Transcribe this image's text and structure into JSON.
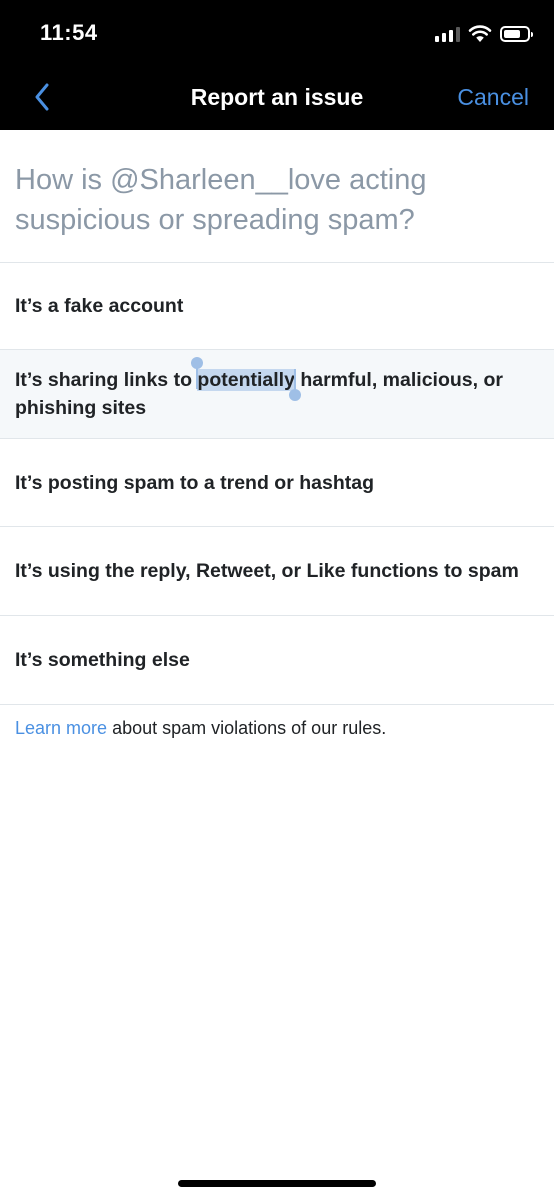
{
  "status_bar": {
    "time": "11:54",
    "signal_bars_active": 3,
    "signal_bars_total": 4,
    "icons": [
      "cellular-signal-icon",
      "wifi-icon",
      "battery-icon"
    ]
  },
  "nav": {
    "back_icon": "chevron-left-icon",
    "title": "Report an issue",
    "cancel_label": "Cancel"
  },
  "question": "How is @Sharleen__love acting suspicious or spreading spam?",
  "options": [
    {
      "label": "It’s a fake account"
    },
    {
      "label_before": "It’s sharing links to ",
      "label_selected": "potentially",
      "label_after": " harmful, malicious, or phishing sites"
    },
    {
      "label": "It’s posting spam to a trend or hashtag"
    },
    {
      "label": "It’s using the reply, Retweet, or Like functions to spam"
    },
    {
      "label": "It’s something else"
    }
  ],
  "footer": {
    "link_text": "Learn more",
    "text": " about spam violations of our rules."
  },
  "colors": {
    "accent": "#4a90e2",
    "header_bg": "#000000",
    "question_text": "#8b98a6",
    "selection": "#c5d8ef"
  }
}
